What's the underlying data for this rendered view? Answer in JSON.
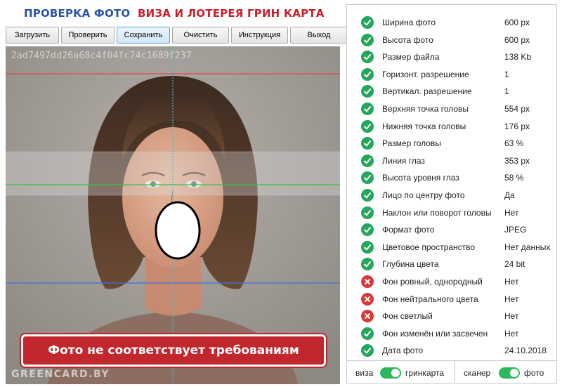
{
  "header": {
    "title_check": "ПРОВЕРКА ФОТО",
    "title_visa": "ВИЗА И ЛОТЕРЕЯ ГРИН КАРТА"
  },
  "toolbar": {
    "load": "Загрузить",
    "check": "Проверить",
    "save": "Сохранить",
    "clear": "Очистить",
    "instruction": "Инструкция",
    "exit": "Выход"
  },
  "photo": {
    "hash": "2ad7497dd26a68c4f04fc74c1689f237",
    "watermark": "GREENCARD.BY",
    "status_banner": "Фото не соответствует требованиям"
  },
  "checks": [
    {
      "label": "Ширина фото",
      "value": "600 px",
      "status": "ok"
    },
    {
      "label": "Высота фото",
      "value": "600 px",
      "status": "ok"
    },
    {
      "label": "Размер файла",
      "value": "138 Kb",
      "status": "ok"
    },
    {
      "label": "Горизонт. разрешение",
      "value": "1",
      "status": "ok"
    },
    {
      "label": "Вертикал. разрешение",
      "value": "1",
      "status": "ok"
    },
    {
      "label": "Верхняя точка головы",
      "value": "554 px",
      "status": "ok"
    },
    {
      "label": "Нижняя точка головы",
      "value": "176 px",
      "status": "ok"
    },
    {
      "label": "Размер головы",
      "value": "63 %",
      "status": "ok"
    },
    {
      "label": "Линия глаз",
      "value": "353 px",
      "status": "ok"
    },
    {
      "label": "Высота уровня глаз",
      "value": "58 %",
      "status": "ok"
    },
    {
      "label": "Лицо по центру фото",
      "value": "Да",
      "status": "ok"
    },
    {
      "label": "Наклон или поворот головы",
      "value": "Нет",
      "status": "ok"
    },
    {
      "label": "Формат фото",
      "value": "JPEG",
      "status": "ok"
    },
    {
      "label": "Цветовое пространство",
      "value": "Нет данных",
      "status": "ok"
    },
    {
      "label": "Глубина цвета",
      "value": "24 bit",
      "status": "ok"
    },
    {
      "label": "Фон ровный, однородный",
      "value": "Нет",
      "status": "bad"
    },
    {
      "label": "Фон нейтрального цвета",
      "value": "Нет",
      "status": "bad"
    },
    {
      "label": "Фон светлый",
      "value": "Нет",
      "status": "bad"
    },
    {
      "label": "Фон изменён или засвечен",
      "value": "Нет",
      "status": "ok"
    },
    {
      "label": "Дата фото",
      "value": "24.10.2018",
      "status": "ok"
    }
  ],
  "switches": {
    "left_off": "виза",
    "left_on": "гринкарта",
    "right_off": "сканер",
    "right_on": "фото",
    "left_state": "on",
    "right_state": "on"
  },
  "colors": {
    "ok": "#26a65b",
    "bad": "#d6393a",
    "title_blue": "#2a54a8",
    "title_red": "#c8202a",
    "banner": "#c1272d",
    "toggle_on": "#2eb85c"
  }
}
